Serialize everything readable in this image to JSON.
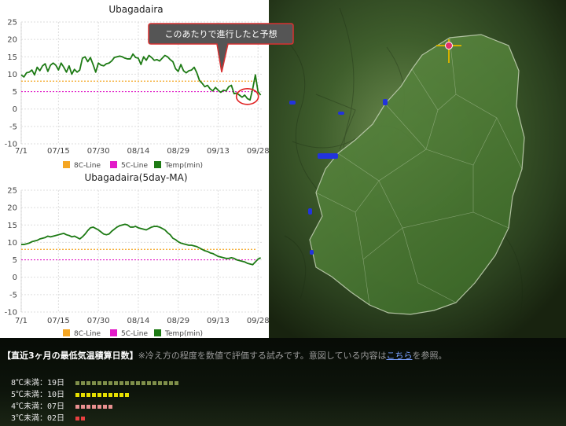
{
  "chart_data": [
    {
      "type": "line",
      "title": "Ubagadaira",
      "ylim": [
        -10,
        25
      ],
      "yticks": [
        -10,
        -5,
        0,
        5,
        10,
        15,
        20,
        25
      ],
      "xticks": [
        "7/1",
        "07/15",
        "07/30",
        "08/14",
        "08/29",
        "09/13",
        "09/28"
      ],
      "xrange_days": [
        0,
        91
      ],
      "series": [
        {
          "name": "8C-Line",
          "color": "#f5a623",
          "style": "dotted",
          "constant": 8
        },
        {
          "name": "5C-Line",
          "color": "#e21ac8",
          "style": "dotted",
          "constant": 5
        },
        {
          "name": "Temp(min)",
          "color": "#1d7a14",
          "style": "solid",
          "values": [
            9.8,
            9.2,
            10.4,
            10.6,
            11.2,
            9.8,
            12.0,
            11.0,
            12.4,
            13.0,
            10.8,
            12.6,
            13.2,
            12.6,
            11.2,
            13.2,
            12.0,
            10.6,
            12.4,
            10.0,
            11.4,
            10.6,
            11.2,
            14.6,
            15.0,
            13.6,
            14.8,
            12.8,
            10.6,
            13.2,
            12.6,
            12.4,
            13.0,
            13.2,
            13.8,
            14.8,
            15.0,
            15.2,
            15.0,
            14.6,
            14.4,
            14.4,
            15.8,
            14.8,
            14.6,
            12.8,
            15.0,
            14.0,
            15.4,
            14.8,
            14.0,
            14.2,
            13.8,
            14.6,
            15.4,
            15.0,
            14.2,
            13.6,
            11.6,
            10.8,
            12.8,
            11.0,
            10.4,
            11.0,
            11.2,
            12.0,
            10.4,
            8.2,
            7.4,
            6.4,
            6.8,
            5.8,
            5.2,
            6.2,
            5.4,
            4.8,
            5.4,
            5.2,
            6.4,
            6.8,
            4.4,
            4.6,
            4.0,
            3.4,
            4.0,
            3.0,
            2.6,
            5.8,
            9.8,
            5.0,
            4.0
          ]
        }
      ],
      "legend": "bottom",
      "annotation": "このあたりで進行したと予想"
    },
    {
      "type": "line",
      "title": "Ubagadaira(5day-MA)",
      "ylim": [
        -10,
        25
      ],
      "yticks": [
        -10,
        -5,
        0,
        5,
        10,
        15,
        20,
        25
      ],
      "xticks": [
        "7/1",
        "07/15",
        "07/30",
        "08/14",
        "08/29",
        "09/13",
        "09/28"
      ],
      "xrange_days": [
        0,
        91
      ],
      "series": [
        {
          "name": "8C-Line",
          "color": "#f5a623",
          "style": "dotted",
          "constant": 8
        },
        {
          "name": "5C-Line",
          "color": "#e21ac8",
          "style": "dotted",
          "constant": 5
        },
        {
          "name": "Temp(min)",
          "color": "#1d7a14",
          "style": "solid",
          "values": [
            9.4,
            9.4,
            9.6,
            9.8,
            10.2,
            10.4,
            10.6,
            11.0,
            11.2,
            11.4,
            11.8,
            11.6,
            11.8,
            12.0,
            12.2,
            12.4,
            12.6,
            12.2,
            12.0,
            11.6,
            11.8,
            11.4,
            11.0,
            11.6,
            12.4,
            13.4,
            14.2,
            14.4,
            14.0,
            13.6,
            13.0,
            12.4,
            12.2,
            12.4,
            13.2,
            13.8,
            14.4,
            14.8,
            15.0,
            15.2,
            15.0,
            14.4,
            14.4,
            14.6,
            14.2,
            14.0,
            13.8,
            13.6,
            14.0,
            14.4,
            14.6,
            14.6,
            14.4,
            14.0,
            13.6,
            12.8,
            12.2,
            11.2,
            10.8,
            10.2,
            9.8,
            9.6,
            9.4,
            9.2,
            9.2,
            9.0,
            8.8,
            8.4,
            8.0,
            7.6,
            7.4,
            7.0,
            6.8,
            6.4,
            6.0,
            5.8,
            5.6,
            5.4,
            5.4,
            5.6,
            5.4,
            5.0,
            4.8,
            4.6,
            4.4,
            4.0,
            3.8,
            3.6,
            4.4,
            5.2,
            5.6
          ]
        }
      ],
      "legend": "bottom"
    }
  ],
  "map": {
    "marker_color": "#e0306a"
  },
  "footer": {
    "heading": "【直近3ヶ月の最低気温積算日数】",
    "description_pre": "※冷え方の程度を数値で評価する試みです。意図している内容は",
    "link_text": "こちら",
    "description_post": "を参照。",
    "rows": [
      {
        "label": "8℃未満：19日",
        "count": 19,
        "color": "#7f8f4a"
      },
      {
        "label": "5℃未満：10日",
        "count": 10,
        "color": "#e8e000"
      },
      {
        "label": "4℃未満：07日",
        "count": 7,
        "color": "#e89090"
      },
      {
        "label": "3℃未満：02日",
        "count": 2,
        "color": "#e84040"
      }
    ]
  }
}
